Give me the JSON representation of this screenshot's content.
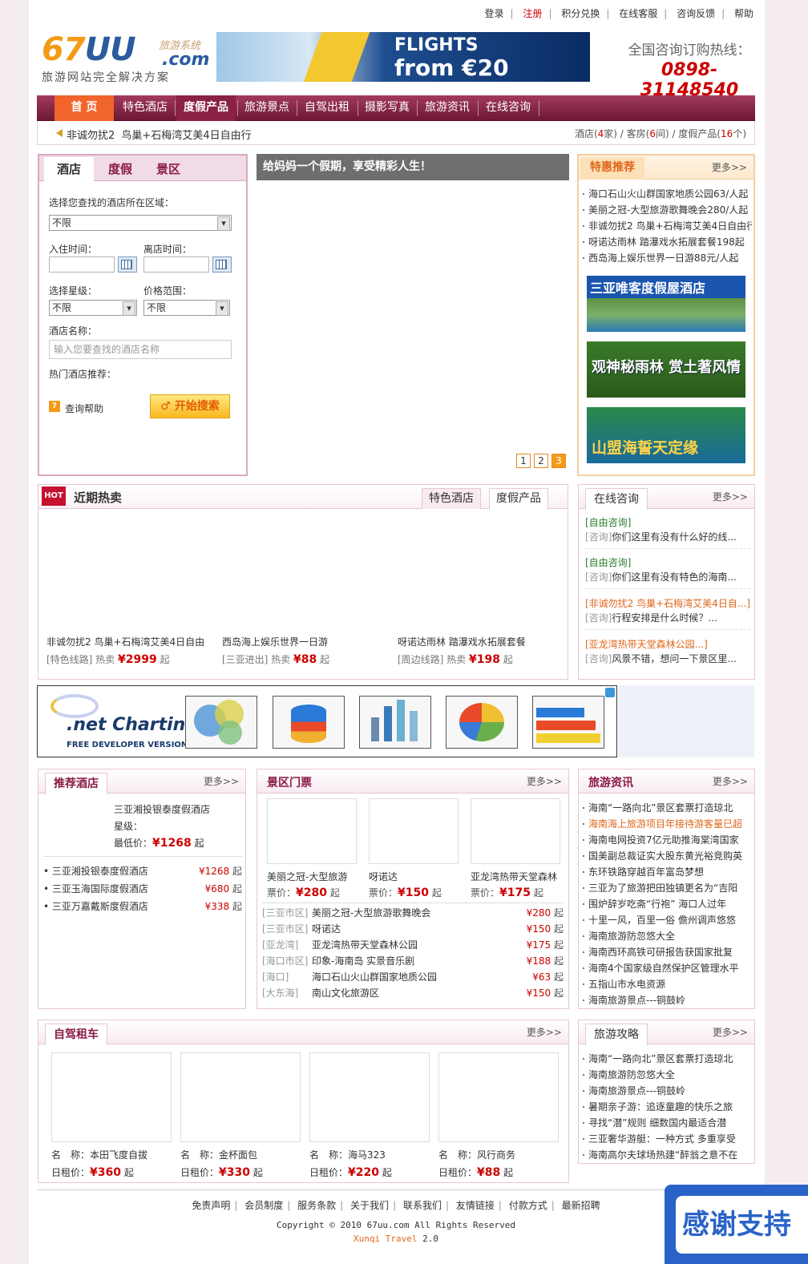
{
  "topnav": {
    "login": "登录",
    "register": "注册",
    "points": "积分兑换",
    "service": "在线客服",
    "feedback": "咨询反馈",
    "help": "帮助"
  },
  "logo": {
    "main_a": "67",
    "main_b": "UU",
    "sys": "旅游系统",
    "com": ".com",
    "slogan": "旅游网站完全解决方案"
  },
  "banner": {
    "line1": "FLIGHTS",
    "line2": "from €20"
  },
  "hotline": {
    "label": "全国咨询订购热线：",
    "number": "0898-31148540"
  },
  "nav": [
    "首 页",
    "特色酒店",
    "度假产品",
    "旅游景点",
    "自驾出租",
    "摄影写真",
    "旅游资讯",
    "在线咨询"
  ],
  "subbar": {
    "news_label": "非诚勿扰2",
    "news_text": "鸟巢+石梅湾艾美4日自由行",
    "hotel_label": "酒店(",
    "hotel_count": "4",
    "hotel_unit": "家)",
    "room_label": "客房(",
    "room_count": "6",
    "room_unit": "间)",
    "prod_label": "度假产品(",
    "prod_count": "16",
    "prod_unit": "个)"
  },
  "search": {
    "tabs": [
      "酒店",
      "度假",
      "景区"
    ],
    "area_label": "选择您查找的酒店所在区域：",
    "area_value": "不限",
    "checkin_label": "入住时间：",
    "checkout_label": "离店时间：",
    "star_label": "选择星级：",
    "star_value": "不限",
    "price_label": "价格范围：",
    "price_value": "不限",
    "name_label": "酒店名称：",
    "name_placeholder": "输入您要查找的酒店名称",
    "hot_label": "热门酒店推荐：",
    "help": "查询帮助",
    "button": "开始搜索"
  },
  "slide": {
    "caption": "给妈妈一个假期，享受精彩人生！",
    "pages": [
      "1",
      "2",
      "3"
    ]
  },
  "special": {
    "title": "特惠推荐",
    "more": "更多>>",
    "items": [
      "海口石山火山群国家地质公园63/人起",
      "美丽之冠-大型旅游歌舞晚会280/人起",
      "非诚勿扰2 鸟巢+石梅湾艾美4日自由行",
      "呀诺达雨林 踏瀑戏水拓展套餐198起",
      "西岛海上娱乐世界一日游88元/人起"
    ],
    "ads": [
      "三亚唯客度假屋酒店",
      "观神秘雨林 赏土著风情",
      "山盟海誓天定缘"
    ]
  },
  "hot": {
    "icon": "HOT",
    "title": "近期热卖",
    "tabs": [
      "特色酒店",
      "度假产品"
    ],
    "products": [
      {
        "name": "非诚勿扰2 鸟巢+石梅湾艾美4日自由",
        "tag": "[特色线路] 热卖",
        "price": "¥2999",
        "unit": "起"
      },
      {
        "name": "西岛海上娱乐世界一日游",
        "tag": "[三亚进出] 热卖",
        "price": "¥88",
        "unit": "起"
      },
      {
        "name": "呀诺达雨林 踏瀑戏水拓展套餐",
        "tag": "[周边线路] 热卖",
        "price": "¥198",
        "unit": "起"
      }
    ]
  },
  "consult": {
    "title": "在线咨询",
    "more": "更多>>",
    "items": [
      {
        "q": "[自由咨询]",
        "a_tag": "[咨询]",
        "a": "你们这里有没有什么好的线...",
        "color": "g"
      },
      {
        "q": "[自由咨询]",
        "a_tag": "[咨询]",
        "a": "你们这里有没有特色的海南...",
        "color": "g"
      },
      {
        "q": "[非诚勿扰2 鸟巢+石梅湾艾美4日自...]",
        "a_tag": "[咨询]",
        "a": "行程安排是什么时候？...",
        "color": "o"
      },
      {
        "q": "[亚龙湾热带天堂森林公园...]",
        "a_tag": "[咨询]",
        "a": "风景不错，想问一下景区里...",
        "color": "o"
      }
    ]
  },
  "chart_ad": {
    "logo": ".net Charting",
    "sub": "FREE DEVELOPER VERSION"
  },
  "rechotel": {
    "title": "推荐酒店",
    "more": "更多>>",
    "feature_name": "三亚湘投银泰度假酒店",
    "star_label": "星级：",
    "min_label": "最低价：",
    "min_price": "¥1268",
    "min_unit": "起",
    "items": [
      {
        "name": "三亚湘投银泰度假酒店",
        "price": "¥1268",
        "unit": "起"
      },
      {
        "name": "三亚玉海国际度假酒店",
        "price": "¥680",
        "unit": "起"
      },
      {
        "name": "三亚万嘉戴斯度假酒店",
        "price": "¥338",
        "unit": "起"
      }
    ]
  },
  "tickets": {
    "title": "景区门票",
    "more": "更多>>",
    "price_label": "票价：",
    "top": [
      {
        "name": "美丽之冠-大型旅游",
        "price": "¥280",
        "unit": "起"
      },
      {
        "name": "呀诺达",
        "price": "¥150",
        "unit": "起"
      },
      {
        "name": "亚龙湾热带天堂森林",
        "price": "¥175",
        "unit": "起"
      }
    ],
    "rows": [
      {
        "region": "[三亚市区]",
        "name": "美丽之冠-大型旅游歌舞晚会",
        "price": "¥280",
        "unit": "起"
      },
      {
        "region": "[三亚市区]",
        "name": "呀诺达",
        "price": "¥150",
        "unit": "起"
      },
      {
        "region": "[亚龙湾]",
        "name": "亚龙湾热带天堂森林公园",
        "price": "¥175",
        "unit": "起"
      },
      {
        "region": "[海口市区]",
        "name": "印象-海南岛 实景音乐剧",
        "price": "¥188",
        "unit": "起"
      },
      {
        "region": "[海口]",
        "name": "海口石山火山群国家地质公园",
        "price": "¥63",
        "unit": "起"
      },
      {
        "region": "[大东海]",
        "name": "南山文化旅游区",
        "price": "¥150",
        "unit": "起"
      }
    ]
  },
  "news": {
    "title": "旅游资讯",
    "more": "更多>>",
    "items": [
      "海南“一路向北”景区套票打造琼北",
      "海南海上旅游项目年接待游客量已超",
      "海南电网投资7亿元助推海棠湾国家",
      "国美副总裁证实大股东黄光裕竞购英",
      "东环铁路穿越百年富岛梦想",
      "三亚为了旅游把田独镇更名为“吉阳",
      "围炉辞岁吃斋“行袍” 海口人过年",
      "十里一风，百里一俗 儋州调声悠悠",
      "海南旅游防忽悠大全",
      "海南西环高铁可研报告获国家批复",
      "海南4个国家级自然保护区管理水平",
      "五指山市水电资源",
      "海南旅游景点---铜鼓岭"
    ]
  },
  "cars": {
    "title": "自驾租车",
    "more": "更多>>",
    "name_label": "名　称：",
    "price_label": "日租价：",
    "items": [
      {
        "name": "本田飞度自拔",
        "price": "¥360",
        "unit": "起"
      },
      {
        "name": "金杯面包",
        "price": "¥330",
        "unit": "起"
      },
      {
        "name": "海马323",
        "price": "¥220",
        "unit": "起"
      },
      {
        "name": "风行商务",
        "price": "¥88",
        "unit": "起"
      }
    ]
  },
  "guide": {
    "title": "旅游攻略",
    "more": "更多>>",
    "items": [
      "海南“一路向北”景区套票打造琼北",
      "海南旅游防忽悠大全",
      "海南旅游景点---铜鼓岭",
      "暑期亲子游：追逐童趣的快乐之旅",
      "寻找“潜”规则 细数国内最适合潜",
      "三亚奢华游艇：一种方式 多重享受",
      "海南高尔夫球场热建“醉翁之意不在"
    ]
  },
  "footer": {
    "links": [
      "免责声明",
      "会员制度",
      "服务条款",
      "关于我们",
      "联系我们",
      "友情链接",
      "付款方式",
      "最新招聘"
    ],
    "copyright": "Copyright © 2010 67uu.com All Rights Reserved",
    "brand": "Xunqi Travel",
    "version": "2.0"
  },
  "thanks": "感谢支持"
}
